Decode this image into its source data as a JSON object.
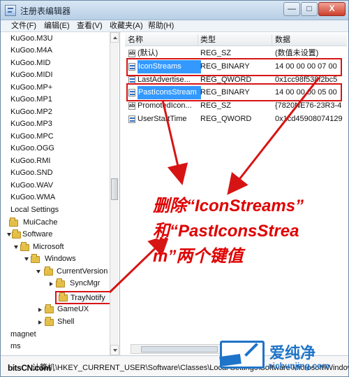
{
  "window": {
    "title": "注册表编辑器",
    "controls": [
      "—",
      "□",
      "X"
    ]
  },
  "menu": [
    "文件(F)",
    "编辑(E)",
    "查看(V)",
    "收藏夹(A)",
    "帮助(H)"
  ],
  "tree": [
    {
      "label": "KuGoo.M3U"
    },
    {
      "label": "KuGoo.M4A"
    },
    {
      "label": "KuGoo.MID"
    },
    {
      "label": "KuGoo.MIDI"
    },
    {
      "label": "KuGoo.MP+"
    },
    {
      "label": "KuGoo.MP1"
    },
    {
      "label": "KuGoo.MP2"
    },
    {
      "label": "KuGoo.MP3"
    },
    {
      "label": "KuGoo.MPC"
    },
    {
      "label": "KuGoo.OGG"
    },
    {
      "label": "KuGoo.RMI"
    },
    {
      "label": "KuGoo.SND"
    },
    {
      "label": "KuGoo.WAV"
    },
    {
      "label": "KuGoo.WMA"
    },
    {
      "label": "Local Settings"
    },
    {
      "label": "MuiCache"
    },
    {
      "label": "Software"
    },
    {
      "label": "Microsoft"
    },
    {
      "label": "Windows"
    },
    {
      "label": "CurrentVersion"
    },
    {
      "label": "SyncMgr"
    },
    {
      "label": "TrayNotify"
    },
    {
      "label": "GameUX"
    },
    {
      "label": "Shell"
    },
    {
      "label": "magnet"
    },
    {
      "label": "ms"
    }
  ],
  "columns": {
    "name": "名称",
    "type": "类型",
    "data": "数据"
  },
  "values": [
    {
      "name": "(默认)",
      "type": "REG_SZ",
      "data": "(数值未设置)",
      "icon": "string-value-icon",
      "icon_text": "ab"
    },
    {
      "name": "IconStreams",
      "type": "REG_BINARY",
      "data": "14 00 00 00 07 00",
      "icon": "binary-value-icon",
      "icon_text": ""
    },
    {
      "name": "LastAdvertise...",
      "type": "REG_QWORD",
      "data": "0x1cc98f538f2bc5",
      "icon": "binary-value-icon",
      "icon_text": ""
    },
    {
      "name": "PastIconsStream",
      "type": "REG_BINARY",
      "data": "14 00 00 00 05 00",
      "icon": "binary-value-icon",
      "icon_text": ""
    },
    {
      "name": "PromotedIcon...",
      "type": "REG_SZ",
      "data": "{7820NE76-23R3-4",
      "icon": "string-value-icon",
      "icon_text": "ab"
    },
    {
      "name": "UserStartTime",
      "type": "REG_QWORD",
      "data": "0x1cd45908074129",
      "icon": "binary-value-icon",
      "icon_text": ""
    }
  ],
  "status": {
    "path": "计算机\\HKEY_CURRENT_USER\\Software\\Classes\\Local Settings\\Software\\Microsoft\\Windows\\CurrentVersion\\TrayNotify"
  },
  "annotation": {
    "line1": "删除“IconStreams”",
    "line2": "和“PastIconsStrea",
    "line3": "m”两个键值"
  },
  "watermark": {
    "left": "bitsCN.com",
    "title": "爱纯净",
    "url": "aichunjing.com"
  },
  "colors": {
    "annotation": "#e00000",
    "selection": "#3399ff",
    "watermark": "#1e74c8"
  }
}
